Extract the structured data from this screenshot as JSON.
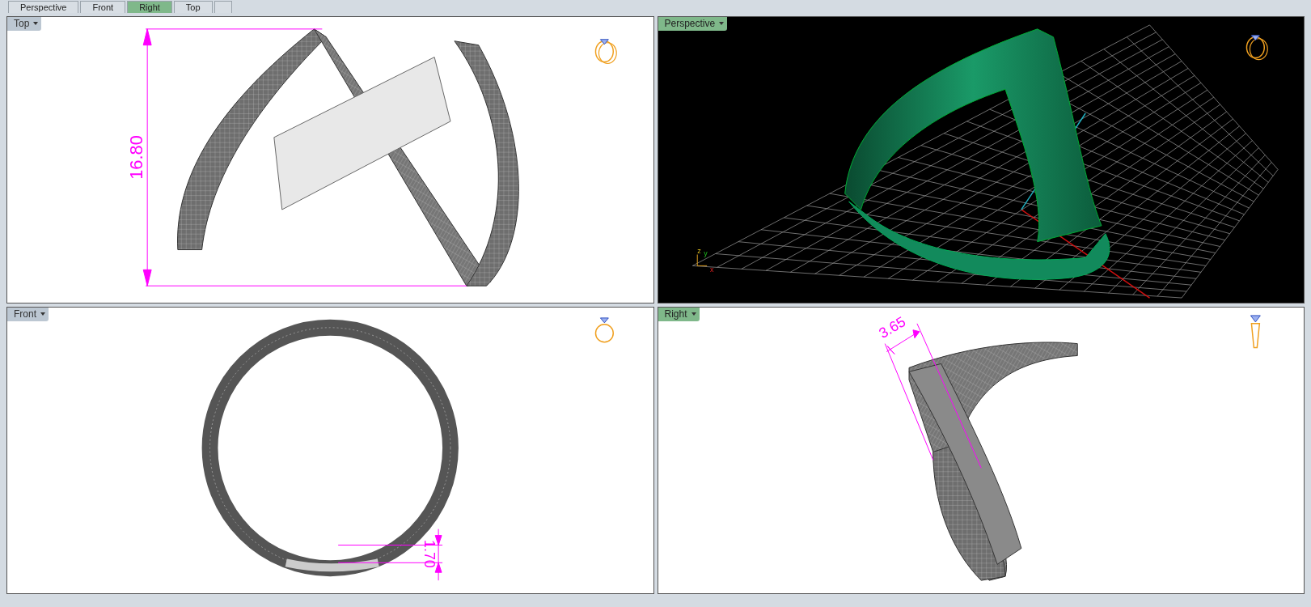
{
  "tabs": [
    {
      "label": "Perspective",
      "selected": false
    },
    {
      "label": "Front",
      "selected": false
    },
    {
      "label": "Right",
      "selected": true
    },
    {
      "label": "Top",
      "selected": false
    }
  ],
  "viewports": [
    {
      "kind": "top",
      "label": "Top",
      "active": false,
      "dimension": "16.80"
    },
    {
      "kind": "perspective",
      "label": "Perspective",
      "active": true,
      "axis_labels": [
        "z",
        "y",
        "x"
      ]
    },
    {
      "kind": "front",
      "label": "Front",
      "active": false,
      "dimension": "1.70"
    },
    {
      "kind": "right",
      "label": "Right",
      "active": true,
      "dimension": "3.65"
    }
  ]
}
